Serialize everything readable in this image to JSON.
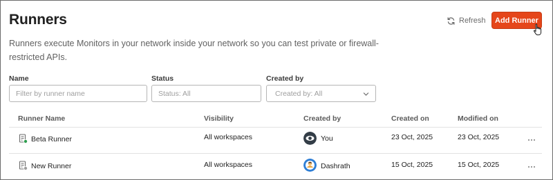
{
  "page": {
    "title": "Runners",
    "description": "Runners execute Monitors in your network inside your network so you can test private or firewall-restricted APIs."
  },
  "toolbar": {
    "refresh_label": "Refresh",
    "add_label": "Add Runner"
  },
  "filters": {
    "name": {
      "label": "Name",
      "placeholder": "Filter by runner name"
    },
    "status": {
      "label": "Status",
      "placeholder": "Status: All"
    },
    "created_by": {
      "label": "Created by",
      "placeholder": "Created by: All"
    }
  },
  "table": {
    "columns": [
      "Runner Name",
      "Visibility",
      "Created by",
      "Created on",
      "Modified on"
    ],
    "rows": [
      {
        "name": "Beta Runner",
        "visibility": "All workspaces",
        "created_by": "You",
        "created_on": "23 Oct, 2025",
        "modified_on": "23 Oct, 2025",
        "status_icon": "runner-online-icon",
        "status_color": "#2e9e4f"
      },
      {
        "name": "New Runner",
        "visibility": "All workspaces",
        "created_by": "Dashrath",
        "created_on": "15 Oct, 2025",
        "modified_on": "15 Oct, 2025",
        "status_icon": "runner-offline-icon",
        "status_color": "#9e9e9e"
      }
    ]
  },
  "colors": {
    "accent": "#e5461a"
  }
}
